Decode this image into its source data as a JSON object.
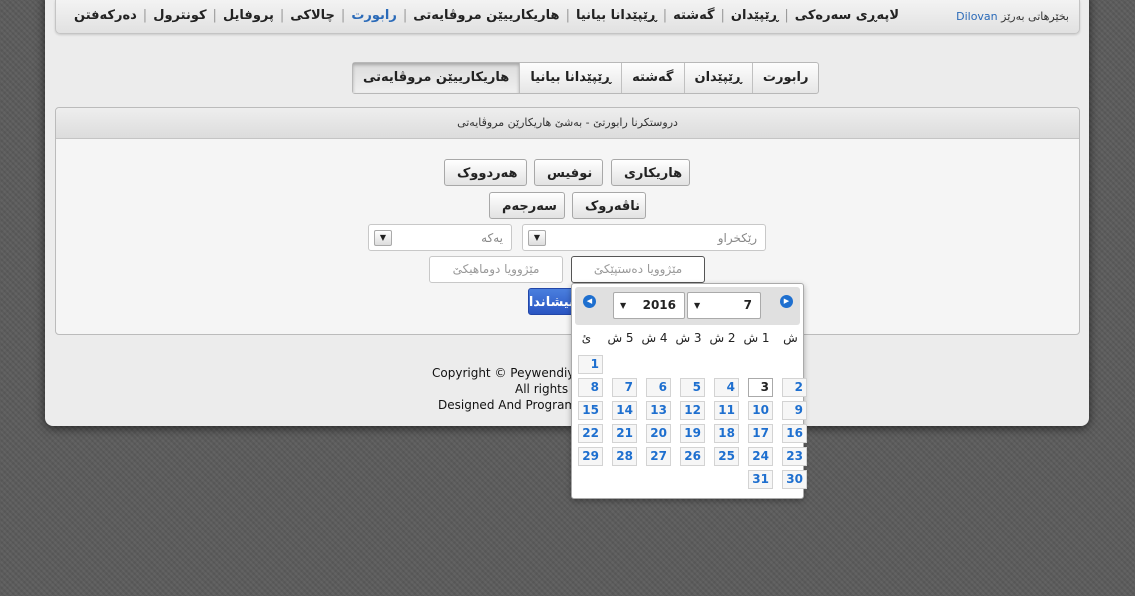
{
  "navbar": {
    "greeting": "بخێرهاتی بەرێز",
    "username": "Dilovan",
    "menu": [
      {
        "label": "لاپەڕی سەرەکی",
        "active": false
      },
      {
        "label": "ڕێپێدان",
        "active": false
      },
      {
        "label": "گەشتە",
        "active": false
      },
      {
        "label": "ڕێپێدانا بیانیا",
        "active": false
      },
      {
        "label": "هاریکارییێن مروڤایەتی",
        "active": false
      },
      {
        "label": "رابورت",
        "active": true
      },
      {
        "label": "چالاکی",
        "active": false
      },
      {
        "label": "پروفایل",
        "active": false
      },
      {
        "label": "کونترول",
        "active": false
      },
      {
        "label": "دەرکەفتن",
        "active": false
      }
    ]
  },
  "tabs": [
    {
      "label": "رابورت",
      "active": false
    },
    {
      "label": "ڕێپێدان",
      "active": false
    },
    {
      "label": "گەشتە",
      "active": false
    },
    {
      "label": "ڕێپێدانا بیانیا",
      "active": false
    },
    {
      "label": "هاریکارییێن مروڤایەتی",
      "active": true
    }
  ],
  "report": {
    "title": "دروستکرنا رابورتێ - بەشێ هاریکارێن مروڤایەتی",
    "buttons": {
      "haryakari": "هاریکاری",
      "nofis": "نوفیس",
      "hardwk": "هەردووک",
      "naverok": "ناڤەروک",
      "serjem": "سەرجەم"
    },
    "select_org": {
      "value": "رێکخراو"
    },
    "select_unit": {
      "value": "یەکە"
    },
    "date_start_placeholder": "مێژوویا دەستپێکێ",
    "date_end_placeholder": "مێژوویا دوماهیکێ",
    "submit_label": "نیشاندان"
  },
  "footer": {
    "copyright": "Copyright © Peywendiyê",
    "rights": "All rights r",
    "designed": "Designed And Program"
  },
  "calendar": {
    "month": "7",
    "year": "2016",
    "weekdays": [
      "ش",
      "1 ش",
      "2 ش",
      "3 ش",
      "4 ش",
      "5 ش",
      "ئ"
    ],
    "today": "3",
    "rows": [
      [
        "",
        "",
        "",
        "",
        "",
        "",
        "1"
      ],
      [
        "2",
        "3",
        "4",
        "5",
        "6",
        "7",
        "8"
      ],
      [
        "9",
        "10",
        "11",
        "12",
        "13",
        "14",
        "15"
      ],
      [
        "16",
        "17",
        "18",
        "19",
        "20",
        "21",
        "22"
      ],
      [
        "23",
        "24",
        "25",
        "26",
        "27",
        "28",
        "29"
      ],
      [
        "30",
        "31",
        "",
        "",
        "",
        "",
        ""
      ]
    ]
  },
  "colors": {
    "accent": "#2a6ab8",
    "calendar_day": "#1e6fcf",
    "submit": "#2a55c2"
  }
}
